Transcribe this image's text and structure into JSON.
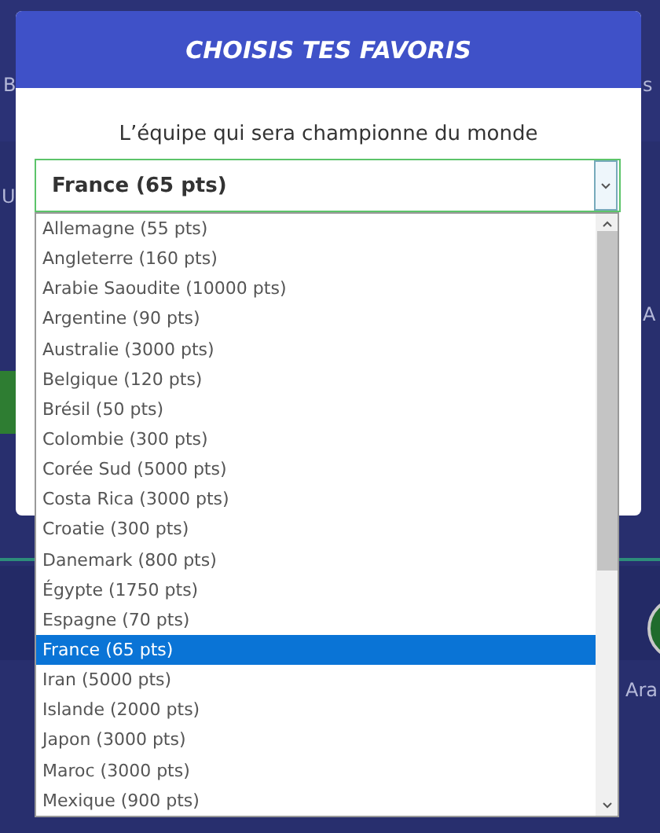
{
  "background": {
    "fragments": [
      "B",
      "s",
      "U",
      "A",
      "Ara"
    ]
  },
  "modal": {
    "title": "CHOISIS TES FAVORIS",
    "question": "L’équipe qui sera championne du monde",
    "select": {
      "value": "France (65 pts)"
    }
  },
  "options": [
    {
      "label": "Allemagne (55 pts)",
      "selected": false
    },
    {
      "label": "Angleterre (160 pts)",
      "selected": false
    },
    {
      "label": "Arabie Saoudite (10000 pts)",
      "selected": false
    },
    {
      "label": "Argentine (90 pts)",
      "selected": false
    },
    {
      "label": "Australie (3000 pts)",
      "selected": false
    },
    {
      "label": "Belgique (120 pts)",
      "selected": false
    },
    {
      "label": "Brésil (50 pts)",
      "selected": false
    },
    {
      "label": "Colombie (300 pts)",
      "selected": false
    },
    {
      "label": "Corée Sud (5000 pts)",
      "selected": false
    },
    {
      "label": "Costa Rica (3000 pts)",
      "selected": false
    },
    {
      "label": "Croatie (300 pts)",
      "selected": false
    },
    {
      "label": "Danemark (800 pts)",
      "selected": false
    },
    {
      "label": "Égypte (1750 pts)",
      "selected": false
    },
    {
      "label": "Espagne (70 pts)",
      "selected": false
    },
    {
      "label": "France (65 pts)",
      "selected": true
    },
    {
      "label": "Iran (5000 pts)",
      "selected": false
    },
    {
      "label": "Islande (2000 pts)",
      "selected": false
    },
    {
      "label": "Japon (3000 pts)",
      "selected": false
    },
    {
      "label": "Maroc (3000 pts)",
      "selected": false
    },
    {
      "label": "Mexique (900 pts)",
      "selected": false
    }
  ]
}
